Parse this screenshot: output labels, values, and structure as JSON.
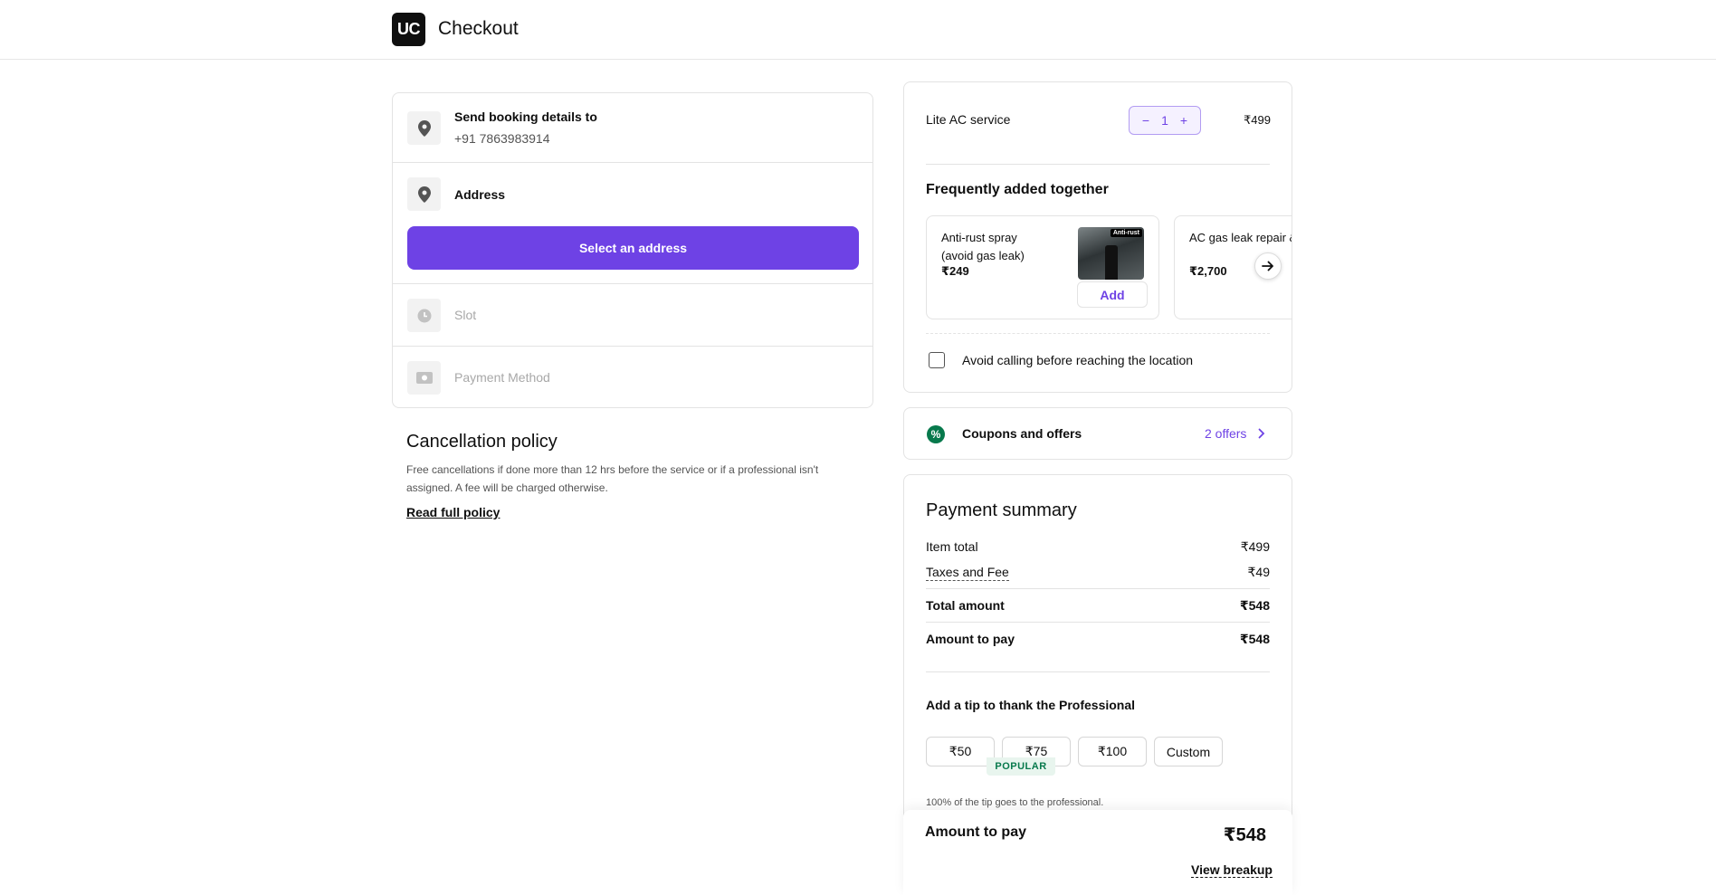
{
  "header": {
    "logo_text": "UC",
    "title": "Checkout"
  },
  "booking": {
    "send_details": {
      "title": "Send booking details to",
      "phone": "+91 7863983914"
    },
    "address": {
      "title": "Address",
      "button_label": "Select an address"
    },
    "slot": {
      "title": "Slot"
    },
    "payment_method": {
      "title": "Payment Method"
    }
  },
  "cancellation": {
    "title": "Cancellation policy",
    "text": "Free cancellations if done more than 12 hrs before the service or if a professional isn't assigned. A fee will be charged otherwise.",
    "link": "Read full policy"
  },
  "cart": {
    "service_name": "Lite AC service",
    "quantity": "1",
    "minus": "−",
    "plus": "+",
    "price": "₹499",
    "frequently_title": "Frequently added together",
    "addons": [
      {
        "name": "Anti-rust spray (avoid gas leak)",
        "price": "₹249",
        "add_label": "Add",
        "image_tag": "Anti-rust"
      },
      {
        "name": "AC gas leak repair & refill",
        "price": "₹2,700"
      }
    ],
    "avoid_calling_label": "Avoid calling before reaching the location"
  },
  "coupons": {
    "label": "Coupons and offers",
    "offers": "2 offers"
  },
  "payment_summary": {
    "title": "Payment summary",
    "rows": [
      {
        "label": "Item total",
        "value": "₹499"
      },
      {
        "label": "Taxes and Fee",
        "value": "₹49"
      },
      {
        "label": "Total amount",
        "value": "₹548"
      },
      {
        "label": "Amount to pay",
        "value": "₹548"
      }
    ],
    "tip_title": "Add a tip to thank the Professional",
    "tips": [
      "₹50",
      "₹75",
      "₹100",
      "Custom"
    ],
    "popular_label": "POPULAR",
    "tip_note": "100% of the tip goes to the professional."
  },
  "sticky_footer": {
    "label": "Amount to pay",
    "amount": "₹548",
    "link": "View breakup"
  },
  "colors": {
    "accent": "#6e42e5",
    "success": "#07794c",
    "text": "#0f0f0f",
    "muted": "#545454",
    "border": "#e3e3e3"
  }
}
